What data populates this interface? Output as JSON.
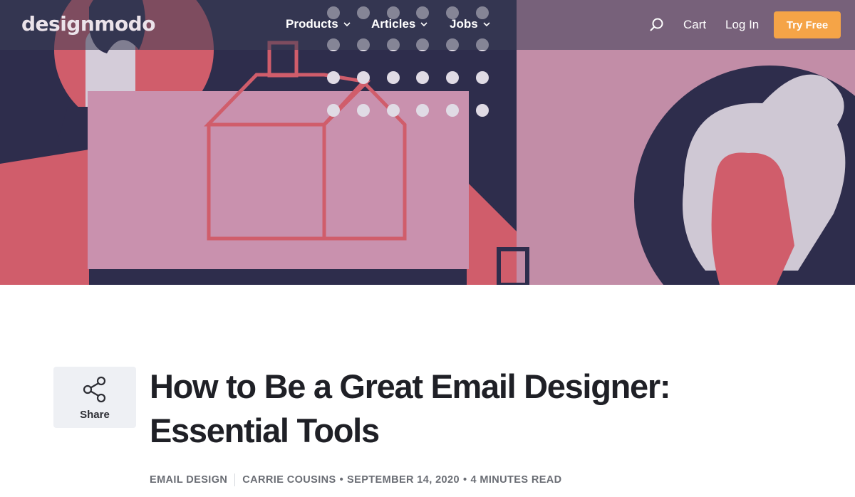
{
  "nav": {
    "logo": "designmodo",
    "items": [
      {
        "label": "Products"
      },
      {
        "label": "Articles"
      },
      {
        "label": "Jobs"
      }
    ],
    "cart_label": "Cart",
    "login_label": "Log In",
    "cta_label": "Try Free"
  },
  "share": {
    "label": "Share"
  },
  "article": {
    "title": "How to Be a Great Email Designer: Essential Tools",
    "category": "EMAIL DESIGN",
    "author": "CARRIE COUSINS",
    "date": "SEPTEMBER 14, 2020",
    "read_time": "4 MINUTES READ",
    "meta_separator": "•"
  },
  "colors": {
    "cta": "#f5a447",
    "navy": "#1c1d3c",
    "coral": "#d4545f",
    "pink": "#cc8fab",
    "title": "#1f2026",
    "meta": "#6a6d74"
  },
  "icons": [
    "chevron-down-icon",
    "search-icon",
    "share-icon"
  ]
}
